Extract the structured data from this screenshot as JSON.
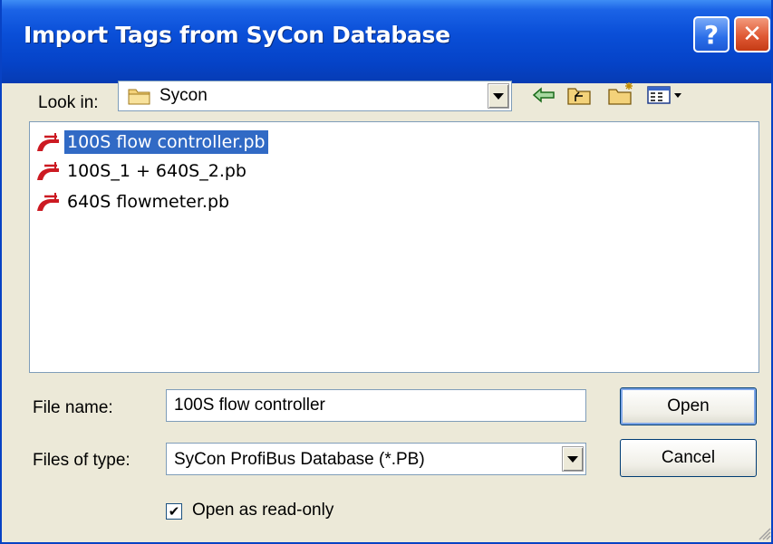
{
  "window": {
    "title": "Import Tags from SyCon Database",
    "help_label": "?",
    "close_label": "✕"
  },
  "look_in": {
    "label": "Look in:",
    "value": "Sycon"
  },
  "toolbar": {
    "icons": [
      "back-arrow-icon",
      "up-folder-icon",
      "new-folder-icon",
      "view-menu-icon"
    ]
  },
  "files": [
    {
      "name": "100S flow controller.pb",
      "selected": true
    },
    {
      "name": "100S_1 + 640S_2.pb",
      "selected": false
    },
    {
      "name": "640S flowmeter.pb",
      "selected": false
    }
  ],
  "file_name": {
    "label": "File name:",
    "value": "100S flow controller"
  },
  "file_type": {
    "label": "Files of type:",
    "value": "SyCon ProfiBus Database  (*.PB)"
  },
  "buttons": {
    "open": "Open",
    "cancel": "Cancel"
  },
  "read_only": {
    "label": "Open as read-only",
    "checked": true
  },
  "colors": {
    "titlebar": "#0a4fd8",
    "selection": "#316ac5",
    "dialog_bg": "#ece9d8",
    "file_icon": "#cc1a22"
  }
}
